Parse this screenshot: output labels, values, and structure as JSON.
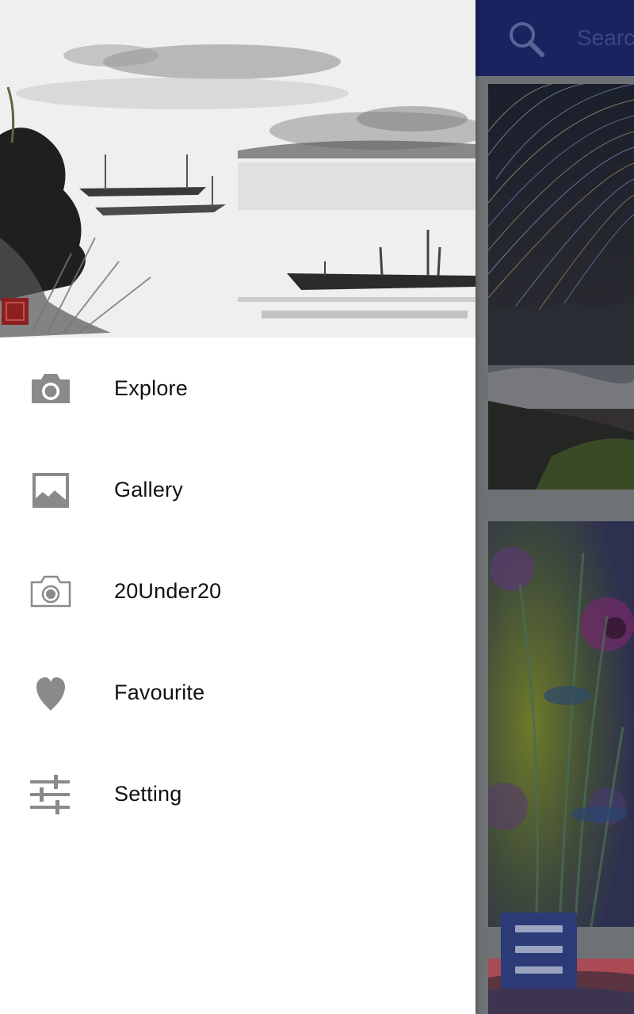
{
  "app_bar": {
    "search_text": "Search",
    "search_icon": "search-icon"
  },
  "drawer": {
    "header_image": "ink-painting-boats-lake",
    "items": [
      {
        "label": "Explore",
        "icon": "camera-icon"
      },
      {
        "label": "Gallery",
        "icon": "image-icon"
      },
      {
        "label": "20Under20",
        "icon": "camera-outline-icon"
      },
      {
        "label": "Favourite",
        "icon": "heart-icon"
      },
      {
        "label": "Setting",
        "icon": "sliders-icon"
      }
    ]
  },
  "feed": {
    "photos": [
      "star-trails-mountains",
      "purple-flowers",
      "sunset-landscape"
    ]
  },
  "fab": {
    "icon": "menu-icon"
  },
  "colors": {
    "app_bar": "#1b2260",
    "fab": "#2c3a78",
    "icon_gray": "#8a8a8a",
    "scrim": "#6e7274"
  }
}
